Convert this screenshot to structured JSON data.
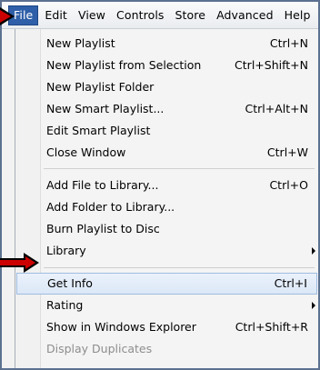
{
  "menubar": {
    "items": [
      {
        "label": "File",
        "active": true
      },
      {
        "label": "Edit",
        "active": false
      },
      {
        "label": "View",
        "active": false
      },
      {
        "label": "Controls",
        "active": false
      },
      {
        "label": "Store",
        "active": false
      },
      {
        "label": "Advanced",
        "active": false
      },
      {
        "label": "Help",
        "active": false
      }
    ]
  },
  "file_menu": {
    "groups": [
      [
        {
          "label": "New Playlist",
          "shortcut": "Ctrl+N"
        },
        {
          "label": "New Playlist from Selection",
          "shortcut": "Ctrl+Shift+N"
        },
        {
          "label": "New Playlist Folder",
          "shortcut": ""
        },
        {
          "label": "New Smart Playlist...",
          "shortcut": "Ctrl+Alt+N"
        },
        {
          "label": "Edit Smart Playlist",
          "shortcut": ""
        },
        {
          "label": "Close Window",
          "shortcut": "Ctrl+W"
        }
      ],
      [
        {
          "label": "Add File to Library...",
          "shortcut": "Ctrl+O"
        },
        {
          "label": "Add Folder to Library...",
          "shortcut": ""
        },
        {
          "label": "Burn Playlist to Disc",
          "shortcut": ""
        },
        {
          "label": "Library",
          "shortcut": "",
          "submenu": true
        }
      ],
      [
        {
          "label": "Get Info",
          "shortcut": "Ctrl+I",
          "highlighted": true
        },
        {
          "label": "Rating",
          "shortcut": "",
          "submenu": true
        },
        {
          "label": "Show in Windows Explorer",
          "shortcut": "Ctrl+Shift+R"
        },
        {
          "label": "Display Duplicates",
          "shortcut": "",
          "disabled": true
        }
      ]
    ]
  },
  "annotations": {
    "arrow_color": "#cc0000",
    "arrows": [
      "pointer-arrow-file-menu",
      "pointer-arrow-get-info"
    ]
  },
  "colors": {
    "menubar_active": "#2f5fa8",
    "highlight_border": "#9fbce1",
    "frame_border": "#5c7190",
    "disabled_text": "#8d8d8d"
  }
}
